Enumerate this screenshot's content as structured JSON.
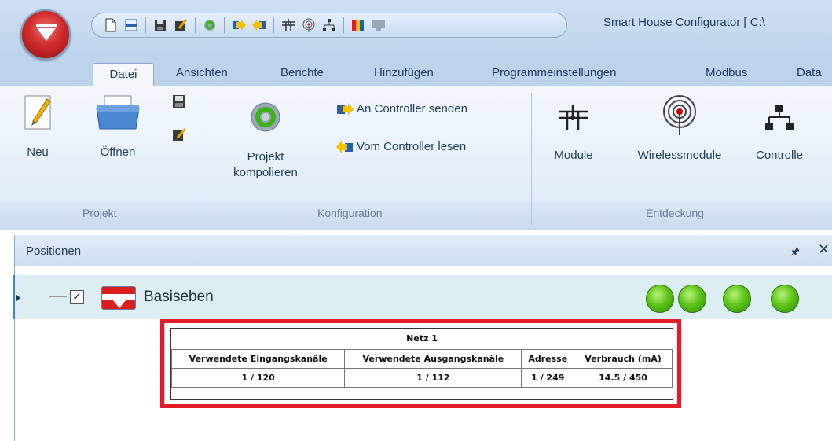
{
  "app": {
    "title": "Smart House Configurator [ C:\\",
    "quick_access_icons": [
      "new-file-icon",
      "open-icon",
      "save-icon",
      "save-as-icon",
      "compile-icon",
      "send-to-controller-icon",
      "read-from-controller-icon",
      "module-icon",
      "wireless-icon",
      "network-icon",
      "color-icon",
      "monitor-icon"
    ]
  },
  "tabs": [
    {
      "label": "Datei",
      "active": true
    },
    {
      "label": "Ansichten"
    },
    {
      "label": "Berichte"
    },
    {
      "label": "Hinzufügen"
    },
    {
      "label": "Programmeinstellungen"
    },
    {
      "label": "Modbus"
    },
    {
      "label": "Data"
    }
  ],
  "ribbon": {
    "projekt": {
      "label": "Projekt",
      "neu": "Neu",
      "oeffnen": "Öffnen"
    },
    "konfiguration": {
      "label": "Konfiguration",
      "projekt_kompilieren_line1": "Projekt",
      "projekt_kompilieren_line2": "kompolieren",
      "an_controller_senden": "An Controller senden",
      "vom_controller_lesen": "Vom Controller lesen"
    },
    "entdeckung": {
      "label": "Entdeckung",
      "module": "Module",
      "wirelessmodule": "Wirelessmodule",
      "controller": "Controlle"
    }
  },
  "panel": {
    "title": "Positionen",
    "row": {
      "label": "Basiseben",
      "checked": true,
      "status_dots": [
        "#5fc418",
        "#5fc418",
        "#5fc418",
        "#5fc418"
      ]
    }
  },
  "popup": {
    "title": "Netz 1",
    "headers": [
      "Verwendete Eingangskanäle",
      "Verwendete Ausgangskanäle",
      "Adresse",
      "Verbrauch (mA)"
    ],
    "values": [
      "1 / 120",
      "1 / 112",
      "1 / 249",
      "14.5 / 450"
    ],
    "highlight_color": "#e21c2a"
  },
  "colors": {
    "ribbon_bg": "#dde9f6",
    "accent": "#d81e1e",
    "status_green": "#5fc418"
  }
}
